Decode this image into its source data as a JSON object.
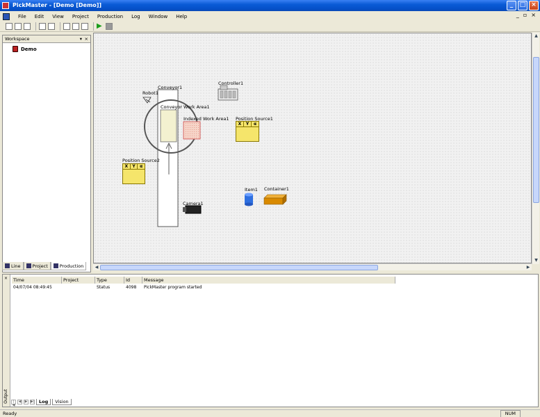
{
  "app": {
    "title": "PickMaster - [Demo [Demo]]"
  },
  "menu": [
    "File",
    "Edit",
    "View",
    "Project",
    "Production",
    "Log",
    "Window",
    "Help"
  ],
  "workspace": {
    "title": "Workspace",
    "tree_root": "Demo",
    "tabs": [
      "Line",
      "Project",
      "Production"
    ]
  },
  "canvas": {
    "labels": {
      "robot1": "Robot1",
      "conveyor1": "Conveyor1",
      "conveyor_work_area": "Conveyor Work Area1",
      "indexed_work_area": "Indexed Work Area1",
      "controller1": "Controller1",
      "position_source1": "Position Source1",
      "position_source2": "Position Source2",
      "camera1": "Camera1",
      "item1": "Item1",
      "container1": "Container1"
    },
    "table_headers": [
      "X",
      "Y",
      "α"
    ]
  },
  "log": {
    "columns": [
      "Time",
      "Project",
      "Type",
      "Id",
      "Message"
    ],
    "rows": [
      {
        "time": "04/07/04 08:49:45",
        "project": "",
        "type": "Status",
        "id": "4098",
        "message": "PickMaster program started"
      }
    ],
    "tabs": [
      "Log",
      "Vision"
    ],
    "side_label": "Output"
  },
  "status": {
    "text": "Ready",
    "num": "NUM"
  },
  "colors": {
    "titlebar": "#0a5bd6",
    "position_source": "#f5e56b",
    "container": "#d98a00",
    "item": "#2e6fe0"
  }
}
